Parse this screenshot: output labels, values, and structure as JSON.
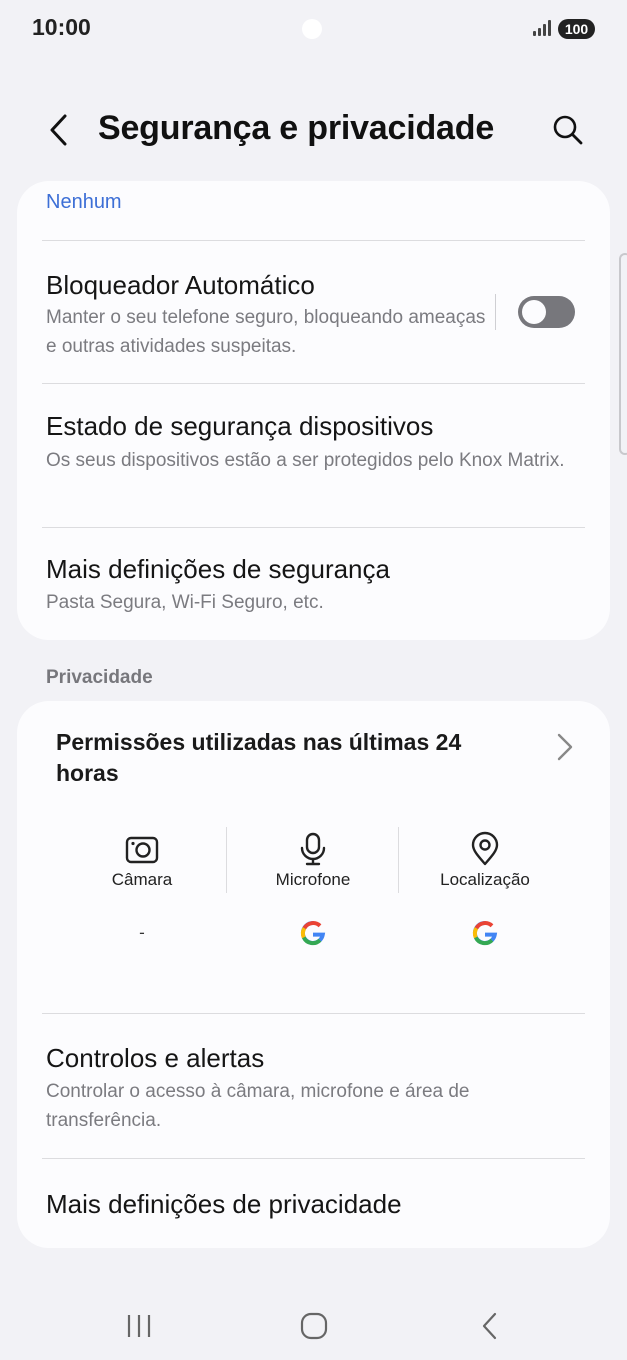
{
  "status": {
    "time": "10:00",
    "battery": "100"
  },
  "header": {
    "title": "Segurança e privacidade"
  },
  "security": {
    "top_value": "Nenhum",
    "items": [
      {
        "title": "Bloqueador Automático",
        "subtitle": "Manter o seu telefone seguro, bloqueando ameaças e outras atividades suspeitas.",
        "toggle_on": false
      },
      {
        "title": "Estado de segurança dispositivos",
        "subtitle": "Os seus dispositivos estão a ser protegidos pelo Knox Matrix."
      },
      {
        "title": "Mais definições de segurança",
        "subtitle": "Pasta Segura, Wi-Fi Seguro, etc."
      }
    ]
  },
  "privacy": {
    "section_header": "Privacidade",
    "permissions": {
      "title": "Permissões utilizadas nas últimas 24 horas",
      "columns": [
        {
          "label": "Câmara",
          "icon": "camera-icon",
          "apps": "-"
        },
        {
          "label": "Microfone",
          "icon": "microphone-icon",
          "apps": "google-icon"
        },
        {
          "label": "Localização",
          "icon": "location-icon",
          "apps": "google-icon"
        }
      ]
    },
    "items": [
      {
        "title": "Controlos e alertas",
        "subtitle": "Controlar o acesso à câmara, microfone e área de transferência."
      },
      {
        "title": "Mais definições de privacidade"
      }
    ]
  },
  "colors": {
    "accent": "#3d6fd6",
    "background": "#f2f2f6",
    "card": "#fcfcfe",
    "toggle_off": "#77777c"
  }
}
